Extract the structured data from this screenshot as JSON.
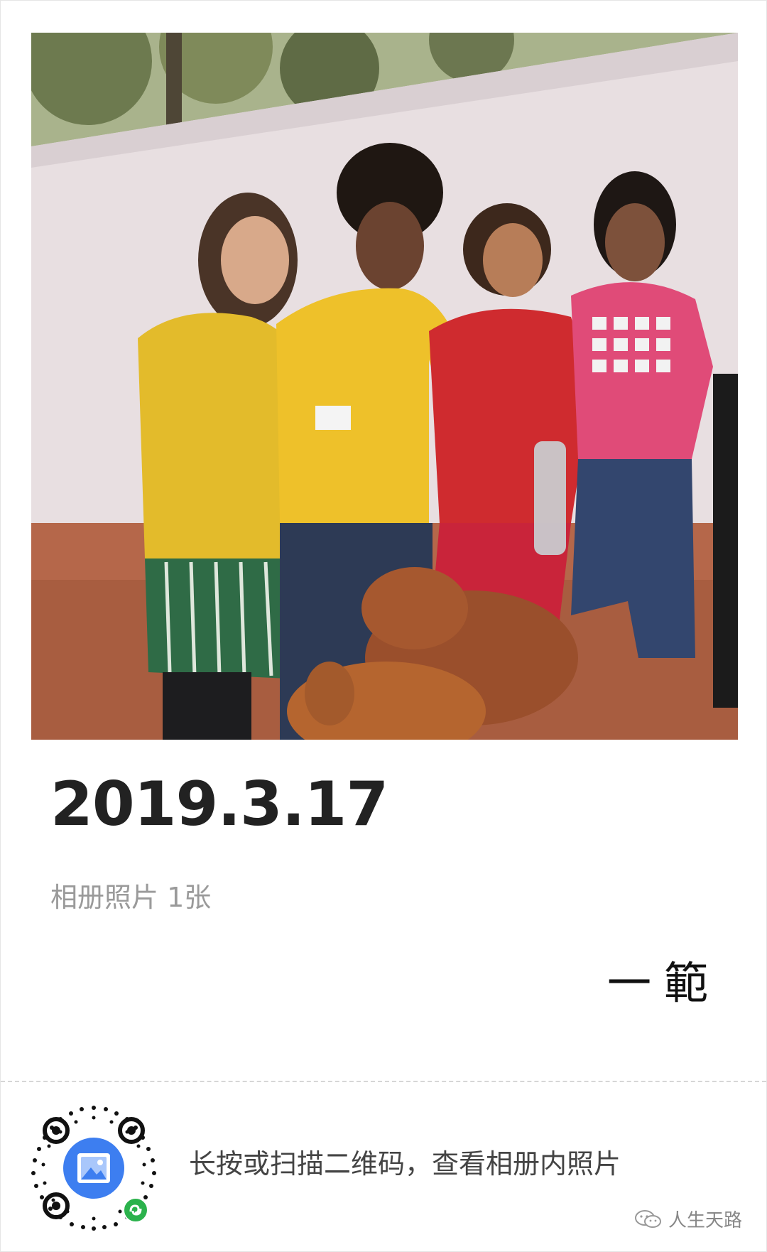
{
  "card": {
    "date": "2019.3.17",
    "subtitle": "相册照片 1张",
    "signature": "一範"
  },
  "footer": {
    "hint": "长按或扫描二维码，查看相册内照片",
    "watermark": "人生天路"
  },
  "icons": {
    "qr_center": "album-icon",
    "mini_program_badge": "mini-program-icon",
    "watermark": "wechat-official-account-icon"
  },
  "colors": {
    "album_icon": "#3d7ef0",
    "mini_program_badge": "#2bb24c",
    "text_primary": "#222222",
    "text_secondary": "#9a9a9a"
  }
}
